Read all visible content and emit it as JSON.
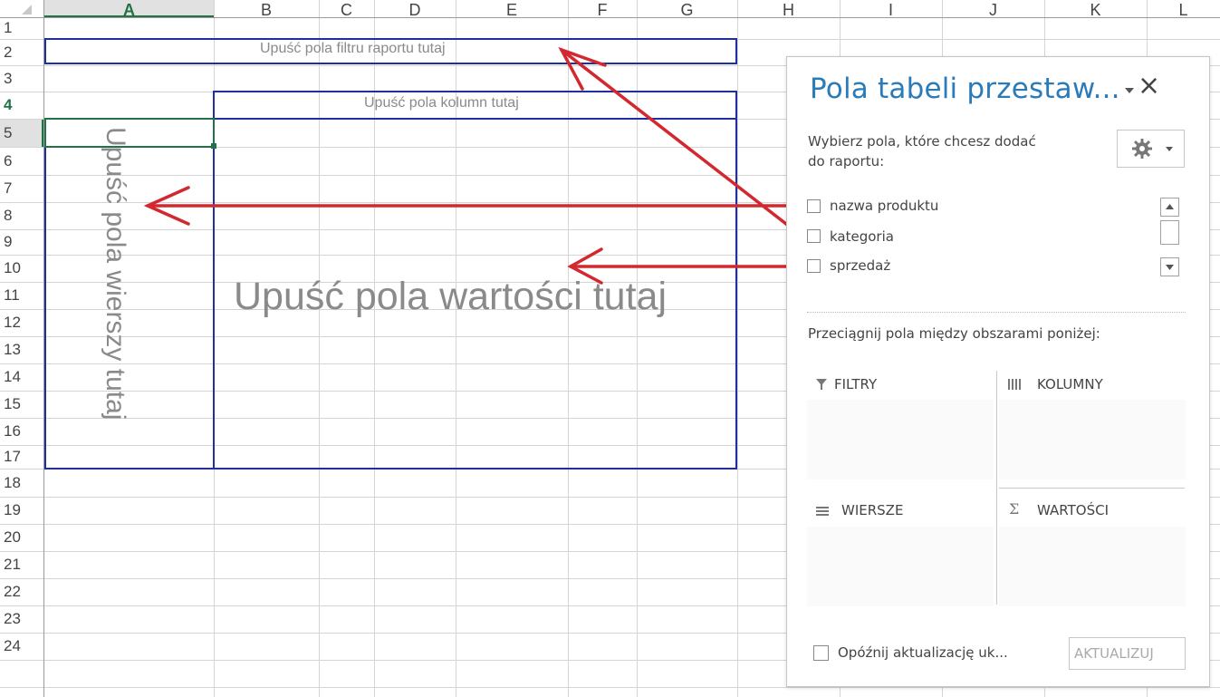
{
  "columns": [
    "A",
    "B",
    "C",
    "D",
    "E",
    "F",
    "G",
    "H",
    "I",
    "J",
    "K",
    "L"
  ],
  "rows": [
    "1",
    "2",
    "3",
    "4",
    "5",
    "6",
    "7",
    "8",
    "9",
    "10",
    "11",
    "12",
    "13",
    "14",
    "15",
    "16",
    "17",
    "18",
    "19",
    "20",
    "21",
    "22",
    "23",
    "24"
  ],
  "pivot_area": {
    "filter_hint": "Upuść pola filtru raportu tutaj",
    "column_hint": "Upuść pola kolumn tutaj",
    "row_hint": "Upuść pola wierszy tutaj",
    "values_hint": "Upuść pola wartości tutaj"
  },
  "panel": {
    "title": "Pola tabeli przestaw...",
    "dropdown_icon": "triangle-down-icon",
    "close_label": "×",
    "subtitle_line1": "Wybierz pola, które chcesz dodać",
    "subtitle_line2": "do raportu:",
    "fields": [
      {
        "label": "nazwa produktu",
        "checked": false
      },
      {
        "label": "kategoria",
        "checked": false
      },
      {
        "label": "sprzedaż",
        "checked": false
      }
    ],
    "drag_text": "Przeciągnij pola między obszarami poniżej:",
    "areas": {
      "filters": "FILTRY",
      "columns": "KOLUMNY",
      "rows": "WIERSZE",
      "values": "WARTOŚCI"
    },
    "defer_label": "Opóźnij aktualizację uk...",
    "update_button": "AKTUALIZUJ"
  },
  "colors": {
    "pivot_border": "#1f2f9e",
    "arrow": "#d3282f",
    "accent": "#2b7bb9",
    "selection": "#217346"
  }
}
